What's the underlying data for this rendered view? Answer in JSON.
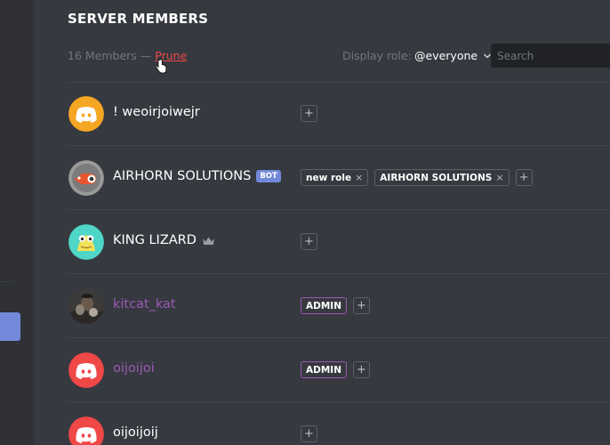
{
  "header": {
    "title": "SERVER MEMBERS"
  },
  "summary": {
    "count_text": "16 Members — ",
    "prune_label": "Prune"
  },
  "filter": {
    "label": "Display role:",
    "selected": "@everyone",
    "search_placeholder": "Search"
  },
  "members": [
    {
      "name": "! weoirjoiwejr",
      "avatar_icon": "discord-logo-icon",
      "avatar_color": "#f5a623",
      "roles": []
    },
    {
      "name": "AIRHORN SOLUTIONS",
      "bot_tag": "BOT",
      "avatar_icon": "airhorn-avatar",
      "avatar_color": "#8a8a8a",
      "roles": [
        {
          "label": "new role"
        },
        {
          "label": "AIRHORN SOLUTIONS"
        }
      ]
    },
    {
      "name": "KING LIZARD",
      "owner_icon": "crown-icon",
      "avatar_icon": "lizard-avatar",
      "avatar_color": "#4fd6c7",
      "roles": []
    },
    {
      "name": "kitcat_kat",
      "name_color": "#9b59b6",
      "avatar_icon": "photo-avatar",
      "roles": [
        {
          "label": "ADMIN"
        }
      ]
    },
    {
      "name": "oijoijoi",
      "name_color": "#9b59b6",
      "avatar_icon": "discord-logo-icon",
      "avatar_color": "#f04747",
      "roles": [
        {
          "label": "ADMIN"
        }
      ]
    },
    {
      "name": "oijoijoij",
      "avatar_icon": "discord-logo-icon",
      "avatar_color": "#f04747",
      "roles": []
    }
  ],
  "remove_glyph": "×",
  "add_glyph": "+",
  "colors": {
    "accent": "#7289da",
    "admin": "#9b59b6",
    "danger": "#f04747",
    "background": "#36393f"
  }
}
